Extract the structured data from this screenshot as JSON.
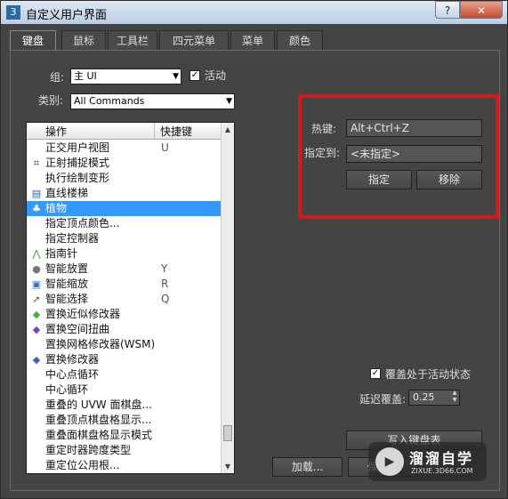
{
  "window": {
    "title": "自定义用户界面",
    "help_label": "?",
    "close_label": "✕"
  },
  "tabs": [
    "键盘",
    "鼠标",
    "工具栏",
    "四元菜单",
    "菜单",
    "颜色"
  ],
  "active_tab_index": 0,
  "group": {
    "label": "组:",
    "value": "主 UI",
    "active_label": "活动",
    "active_checked": true
  },
  "category": {
    "label": "类别:",
    "value": "All Commands"
  },
  "list": {
    "col_action": "操作",
    "col_shortcut": "快捷键",
    "rows": [
      {
        "icon": "",
        "name": "正交用户视图",
        "key": "U"
      },
      {
        "icon": "snap-icon",
        "name": "正射捕捉模式",
        "key": ""
      },
      {
        "icon": "",
        "name": "执行绘制变形",
        "key": ""
      },
      {
        "icon": "stairs-icon",
        "name": "直线楼梯",
        "key": ""
      },
      {
        "icon": "plant-icon",
        "name": "植物",
        "key": "",
        "selected": true
      },
      {
        "icon": "",
        "name": "指定顶点颜色...",
        "key": ""
      },
      {
        "icon": "",
        "name": "指定控制器",
        "key": ""
      },
      {
        "icon": "compass-icon",
        "name": "指南针",
        "key": ""
      },
      {
        "icon": "smart-place-icon",
        "name": "智能放置",
        "key": "Y"
      },
      {
        "icon": "smart-scale-icon",
        "name": "智能缩放",
        "key": "R"
      },
      {
        "icon": "smart-select-icon",
        "name": "智能选择",
        "key": "Q"
      },
      {
        "icon": "modifier-green-icon",
        "name": "置换近似修改器",
        "key": ""
      },
      {
        "icon": "modifier-purple-icon",
        "name": "置换空间扭曲",
        "key": ""
      },
      {
        "icon": "",
        "name": "置换网格修改器(WSM)",
        "key": ""
      },
      {
        "icon": "modifier-blue-icon",
        "name": "置换修改器",
        "key": ""
      },
      {
        "icon": "",
        "name": "中心点循环",
        "key": ""
      },
      {
        "icon": "",
        "name": "中心循环",
        "key": ""
      },
      {
        "icon": "",
        "name": "重叠的 UVW 面棋盘...",
        "key": ""
      },
      {
        "icon": "",
        "name": "重叠顶点棋盘格显示...",
        "key": ""
      },
      {
        "icon": "",
        "name": "重叠面棋盘格显示模式",
        "key": ""
      },
      {
        "icon": "",
        "name": "重定时器跨度类型",
        "key": ""
      },
      {
        "icon": "",
        "name": "重定位公用根...",
        "key": ""
      }
    ]
  },
  "hotkey": {
    "label": "热键:",
    "value": "Alt+Ctrl+Z",
    "assigned_label": "指定到:",
    "assigned_value": "<未指定>",
    "assign_button": "指定",
    "remove_button": "移除"
  },
  "override": {
    "label": "覆盖处于活动状态",
    "checked": true,
    "delay_label": "延迟覆盖:",
    "delay_value": "0.25"
  },
  "buttons": {
    "write_keyboard": "写入键盘表",
    "load": "加载...",
    "save": "保存..."
  },
  "watermark": {
    "name": "溜溜自学",
    "url": "ZIXUE.3D66.COM"
  },
  "colors": {
    "highlight": "#d01c1c",
    "selection": "#3399ff"
  }
}
